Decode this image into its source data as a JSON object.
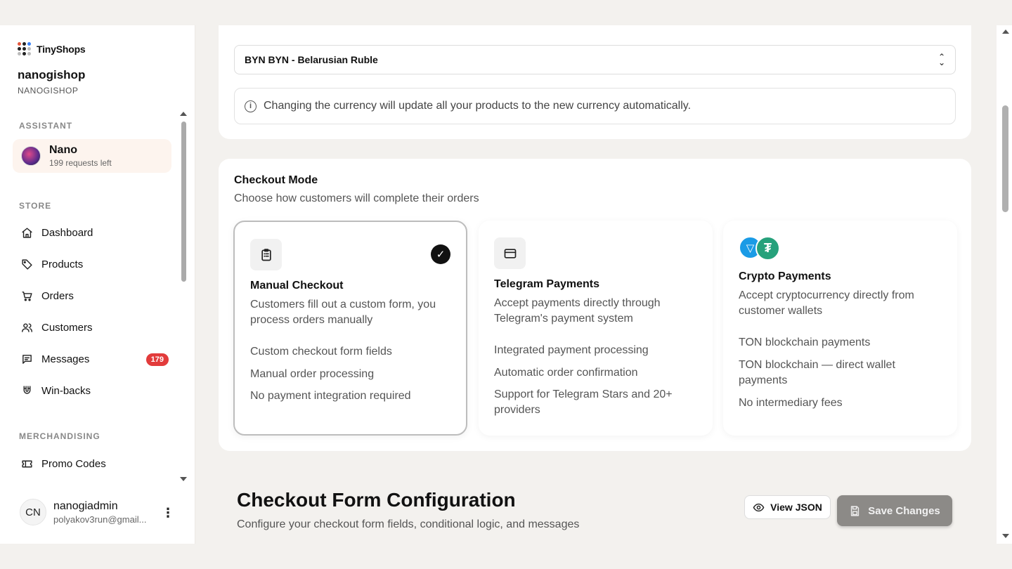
{
  "brand": {
    "logo_text": "TinyShops"
  },
  "shop": {
    "name": "nanogishop",
    "handle": "NANOGISHOP"
  },
  "sidebar": {
    "assistant_label": "ASSISTANT",
    "assistant": {
      "name": "Nano",
      "requests": "199 requests left"
    },
    "store_label": "STORE",
    "items": [
      {
        "label": "Dashboard",
        "icon": "home-icon"
      },
      {
        "label": "Products",
        "icon": "tag-icon"
      },
      {
        "label": "Orders",
        "icon": "cart-icon"
      },
      {
        "label": "Customers",
        "icon": "users-icon"
      },
      {
        "label": "Messages",
        "icon": "message-icon",
        "badge": "179"
      },
      {
        "label": "Win-backs",
        "icon": "magnet-icon"
      }
    ],
    "merch_label": "MERCHANDISING",
    "merch_items": [
      {
        "label": "Promo Codes",
        "icon": "ticket-icon"
      }
    ]
  },
  "user": {
    "initials": "CN",
    "name": "nanogiadmin",
    "email": "polyakov3run@gmail..."
  },
  "currency": {
    "selected": "BYN BYN - Belarusian Ruble",
    "info": "Changing the currency will update all your products to the new currency automatically."
  },
  "checkout_mode": {
    "title": "Checkout Mode",
    "subtitle": "Choose how customers will complete their orders",
    "options": [
      {
        "title": "Manual Checkout",
        "description": "Customers fill out a custom form, you process orders manually",
        "features": [
          "Custom checkout form fields",
          "Manual order processing",
          "No payment integration required"
        ],
        "selected": true
      },
      {
        "title": "Telegram Payments",
        "description": "Accept payments directly through Telegram's payment system",
        "features": [
          "Integrated payment processing",
          "Automatic order confirmation",
          "Support for Telegram Stars and 20+ providers"
        ],
        "selected": false
      },
      {
        "title": "Crypto Payments",
        "description": "Accept cryptocurrency directly from customer wallets",
        "features": [
          "TON blockchain payments",
          "TON blockchain — direct wallet payments",
          "No intermediary fees"
        ],
        "selected": false
      }
    ]
  },
  "config": {
    "title": "Checkout Form Configuration",
    "subtitle": "Configure your checkout form fields, conditional logic, and messages",
    "view_json": "View JSON",
    "save": "Save Changes"
  },
  "colors": {
    "badge": "#e23b3b",
    "save_button": "#8c8a87",
    "assistant_bg": "#fdf4ee"
  }
}
